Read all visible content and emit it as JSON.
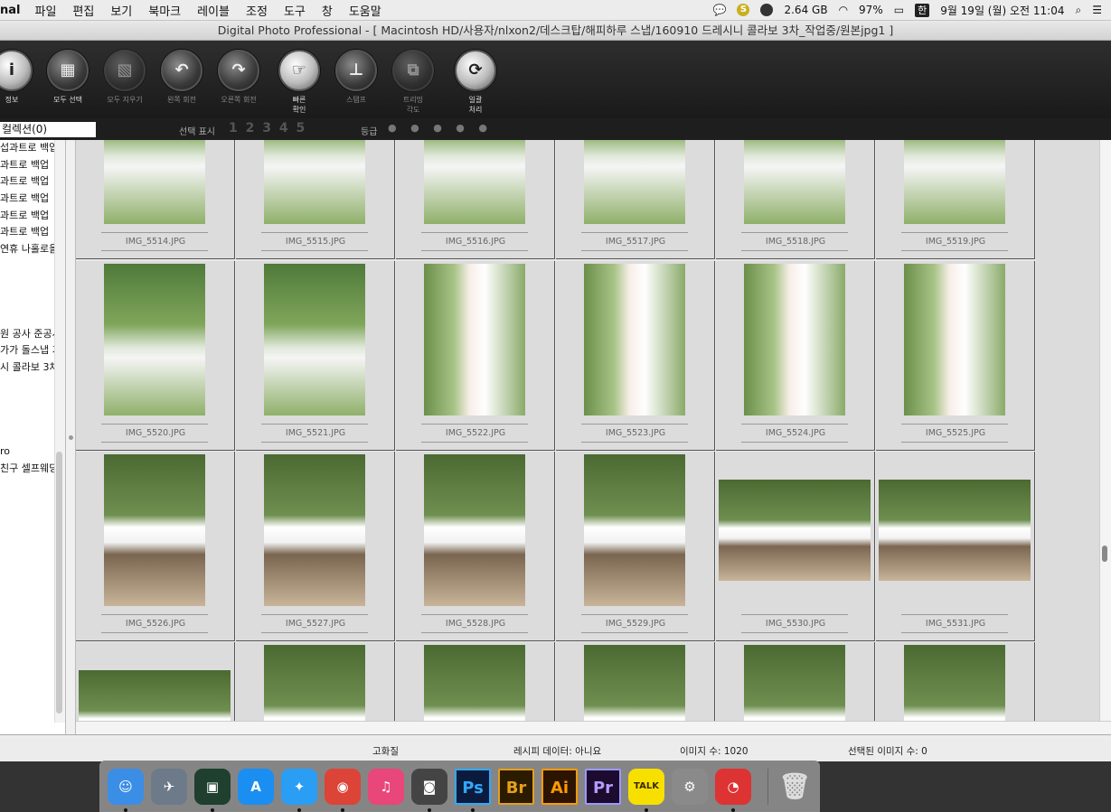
{
  "menubar": {
    "app": "nal",
    "items": [
      "파일",
      "편집",
      "보기",
      "북마크",
      "레이블",
      "조정",
      "도구",
      "창",
      "도움말"
    ],
    "memory": "2.64 GB",
    "battery": "97%",
    "ime": "한",
    "datetime": "9월 19일 (월) 오전 11:04"
  },
  "window": {
    "title": "Digital Photo Professional - [ Macintosh HD/사용자/nlxon2/데스크탑/해피하루 스냅/160910 드레시니 콜라보 3차_작업중/원본jpg1 ]"
  },
  "toolbar": {
    "buttons": [
      {
        "label": "정보",
        "glyph": "i"
      },
      {
        "label": "모두 선택",
        "glyph": "▦"
      },
      {
        "label": "모두 지우기",
        "glyph": "▧"
      },
      {
        "label": "왼쪽 회전",
        "glyph": "↶"
      },
      {
        "label": "오른쪽 회전",
        "glyph": "↷"
      },
      {
        "label": "빠른\n확인",
        "glyph": "☞"
      },
      {
        "label": "스탬프",
        "glyph": "⊥"
      },
      {
        "label": "트리밍\n각도",
        "glyph": "⧉"
      },
      {
        "label": "일괄\n처리",
        "glyph": "⟳"
      }
    ]
  },
  "filterbar": {
    "collection": "컬렉션(0)",
    "selection_label": "선택 표시",
    "selection_numbers": "1 2 3 4 5",
    "grade_label": "등급",
    "grade_dots": "● ● ● ● ●"
  },
  "sidebar": {
    "folders": [
      "섭과트로 백업",
      "과트로 백업",
      "과트로 백업",
      "과트로 백업",
      "과트로 백업",
      "과트로 백업",
      "연휴 나홀로을",
      "",
      "",
      "",
      "",
      "원 공사 준공시",
      "가가 돌스냅 기",
      "시 콜라보 3차",
      "",
      "",
      "",
      "",
      "ro",
      "친구 셀프웨딩"
    ]
  },
  "grid": {
    "rows": [
      [
        {
          "name": "IMG_5514.JPG",
          "orient": "portrait",
          "style": "standing"
        },
        {
          "name": "IMG_5515.JPG",
          "orient": "portrait",
          "style": "standing"
        },
        {
          "name": "IMG_5516.JPG",
          "orient": "portrait",
          "style": "standing"
        },
        {
          "name": "IMG_5517.JPG",
          "orient": "portrait",
          "style": "standing"
        },
        {
          "name": "IMG_5518.JPG",
          "orient": "portrait",
          "style": "standing"
        },
        {
          "name": "IMG_5519.JPG",
          "orient": "portrait",
          "style": "standing"
        }
      ],
      [
        {
          "name": "IMG_5520.JPG",
          "orient": "portrait",
          "style": "standing"
        },
        {
          "name": "IMG_5521.JPG",
          "orient": "portrait",
          "style": "standing"
        },
        {
          "name": "IMG_5522.JPG",
          "orient": "portrait",
          "style": "closeup"
        },
        {
          "name": "IMG_5523.JPG",
          "orient": "portrait",
          "style": "closeup"
        },
        {
          "name": "IMG_5524.JPG",
          "orient": "portrait",
          "style": "closeup"
        },
        {
          "name": "IMG_5525.JPG",
          "orient": "portrait",
          "style": "closeup"
        }
      ],
      [
        {
          "name": "IMG_5526.JPG",
          "orient": "portrait",
          "style": "bench"
        },
        {
          "name": "IMG_5527.JPG",
          "orient": "portrait",
          "style": "bench"
        },
        {
          "name": "IMG_5528.JPG",
          "orient": "portrait",
          "style": "bench"
        },
        {
          "name": "IMG_5529.JPG",
          "orient": "portrait",
          "style": "bench"
        },
        {
          "name": "IMG_5530.JPG",
          "orient": "landscape",
          "style": "bench"
        },
        {
          "name": "IMG_5531.JPG",
          "orient": "landscape",
          "style": "bench"
        }
      ],
      [
        {
          "name": "",
          "orient": "landscape",
          "style": "bench"
        },
        {
          "name": "",
          "orient": "portrait",
          "style": "bench"
        },
        {
          "name": "",
          "orient": "portrait",
          "style": "bench"
        },
        {
          "name": "",
          "orient": "portrait",
          "style": "bench"
        },
        {
          "name": "",
          "orient": "portrait",
          "style": "bench"
        },
        {
          "name": "",
          "orient": "portrait",
          "style": "bench"
        }
      ]
    ]
  },
  "statusbar": {
    "quality": "고화질",
    "recipe": "레시피 데이터: 아니요",
    "image_count": "이미지 수: 1020",
    "selected_count": "선택된 이미지 수: 0"
  },
  "dock": {
    "apps": [
      {
        "name": "finder-icon",
        "glyph": "☺",
        "color": "#3a8ee6",
        "running": true
      },
      {
        "name": "launchpad-icon",
        "glyph": "✈",
        "color": "#6c7a89",
        "running": false
      },
      {
        "name": "photo-viewer-icon",
        "glyph": "▣",
        "color": "#1f3f2f",
        "running": true
      },
      {
        "name": "app-store-icon",
        "glyph": "A",
        "color": "#1b8ef2",
        "running": false
      },
      {
        "name": "safari-icon",
        "glyph": "✦",
        "color": "#2a9df4",
        "running": true
      },
      {
        "name": "chrome-icon",
        "glyph": "◉",
        "color": "#db4437",
        "running": true
      },
      {
        "name": "itunes-icon",
        "glyph": "♫",
        "color": "#e9467a",
        "running": false
      },
      {
        "name": "dpp-icon",
        "glyph": "◙",
        "color": "#444444",
        "running": true
      },
      {
        "name": "photoshop-icon",
        "glyph": "Ps",
        "color": "#0a1b3d",
        "running": true
      },
      {
        "name": "bridge-icon",
        "glyph": "Br",
        "color": "#2b1c00",
        "running": false
      },
      {
        "name": "illustrator-icon",
        "glyph": "Ai",
        "color": "#2b1400",
        "running": false
      },
      {
        "name": "premiere-icon",
        "glyph": "Pr",
        "color": "#1c0b2e",
        "running": false
      },
      {
        "name": "kakaotalk-icon",
        "glyph": "TALK",
        "color": "#f7e000",
        "running": true
      },
      {
        "name": "system-preferences-icon",
        "glyph": "⚙",
        "color": "#8a8a8a",
        "running": false
      },
      {
        "name": "disk-tool-icon",
        "glyph": "◔",
        "color": "#d33",
        "running": true
      }
    ],
    "trash": {
      "name": "trash-icon",
      "glyph": "🗑"
    }
  }
}
